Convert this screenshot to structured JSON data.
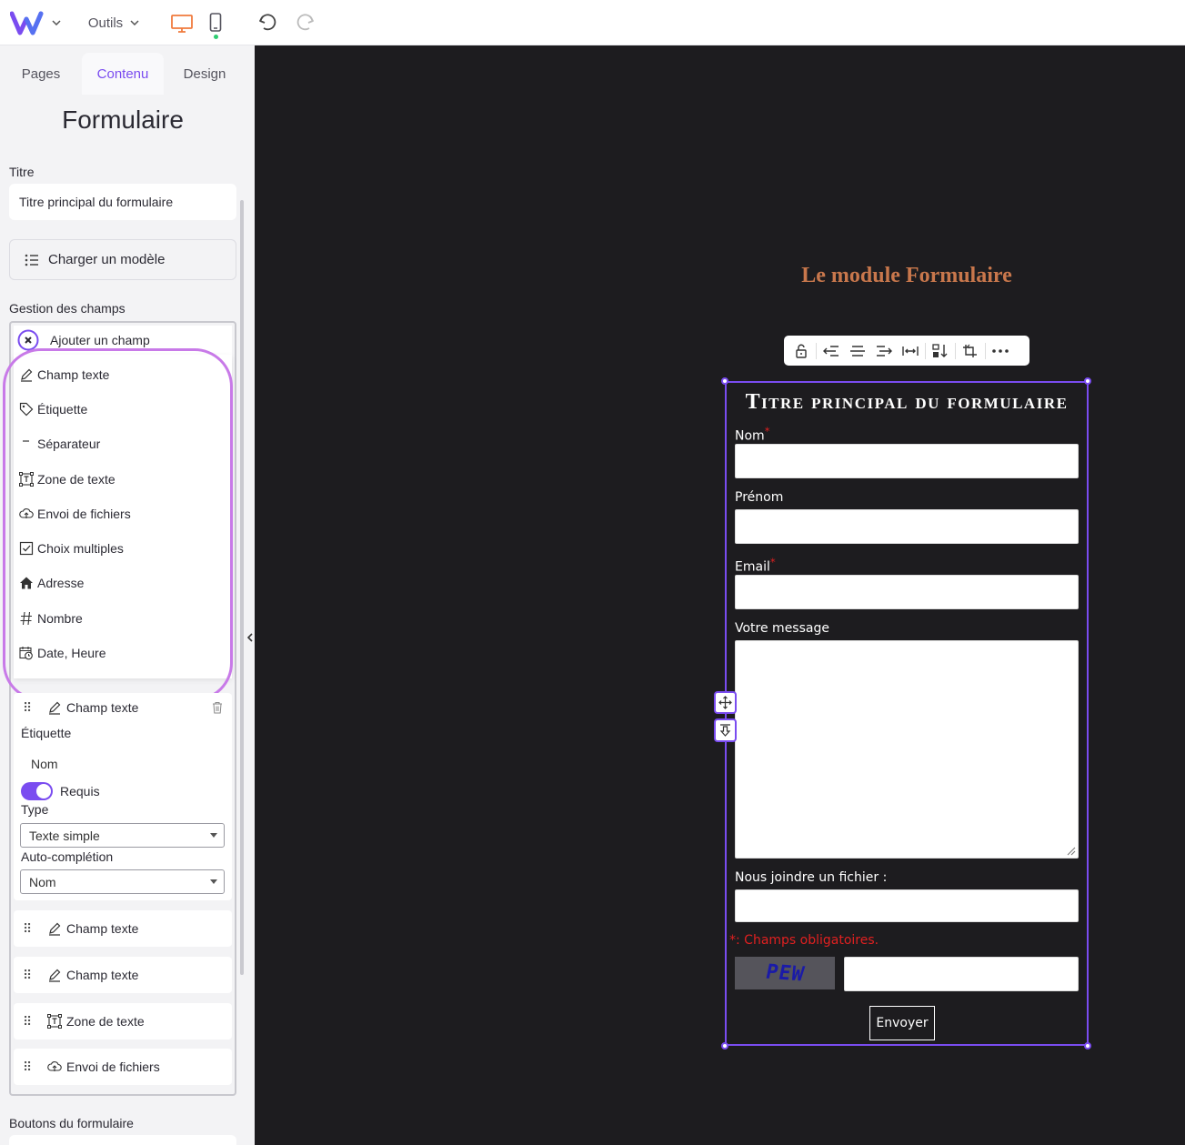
{
  "topbar": {
    "tools_label": "Outils"
  },
  "panel": {
    "tabs": [
      {
        "label": "Pages"
      },
      {
        "label": "Contenu"
      },
      {
        "label": "Design"
      }
    ],
    "heading": "Formulaire",
    "title_label": "Titre",
    "title_value": "Titre principal du formulaire",
    "load_template_label": "Charger un modèle",
    "fields_section_label": "Gestion des champs",
    "add_field_label": "Ajouter un champ",
    "dropdown_items": [
      {
        "label": "Champ texte",
        "icon": "pencil-icon"
      },
      {
        "label": "Étiquette",
        "icon": "tag-icon"
      },
      {
        "label": "Séparateur",
        "icon": "minus-icon"
      },
      {
        "label": "Zone de texte",
        "icon": "text-area-icon"
      },
      {
        "label": "Envoi de fichiers",
        "icon": "cloud-upload-icon"
      },
      {
        "label": "Choix multiples",
        "icon": "checkbox-icon"
      },
      {
        "label": "Adresse",
        "icon": "home-icon"
      },
      {
        "label": "Nombre",
        "icon": "hash-icon"
      },
      {
        "label": "Date, Heure",
        "icon": "calendar-clock-icon"
      }
    ],
    "expanded_field": {
      "title": "Champ texte",
      "label_caption": "Étiquette",
      "label_value": "Nom",
      "required_label": "Requis",
      "required_on": true,
      "type_caption": "Type",
      "type_value": "Texte simple",
      "autocomplete_caption": "Auto-complétion",
      "autocomplete_value": "Nom"
    },
    "field_rows": [
      {
        "label": "Champ texte",
        "icon": "pencil-icon"
      },
      {
        "label": "Champ texte",
        "icon": "pencil-icon"
      },
      {
        "label": "Zone de texte",
        "icon": "text-area-icon"
      },
      {
        "label": "Envoi de fichiers",
        "icon": "cloud-upload-icon"
      }
    ],
    "buttons_section_label": "Boutons du formulaire"
  },
  "canvas": {
    "module_title": "Le module Formulaire",
    "form": {
      "title": "Titre principal du formulaire",
      "fields": [
        {
          "label": "Nom",
          "required": "*"
        },
        {
          "label": "Prénom",
          "required": ""
        },
        {
          "label": "Email",
          "required": "*"
        },
        {
          "label": "Votre message",
          "required": ""
        },
        {
          "label": "Nous joindre un fichier :",
          "required": ""
        }
      ],
      "required_note_mark": "*",
      "required_note": ": Champs obligatoires.",
      "captcha_text": "PEW",
      "submit_label": "Envoyer"
    }
  },
  "colors": {
    "accent": "#7a4cf0",
    "desktop_icon": "#f07a3c",
    "module_title": "#c8774c",
    "highlight_ring": "#c87ae8",
    "canvas_bg": "#1d1c1f"
  }
}
